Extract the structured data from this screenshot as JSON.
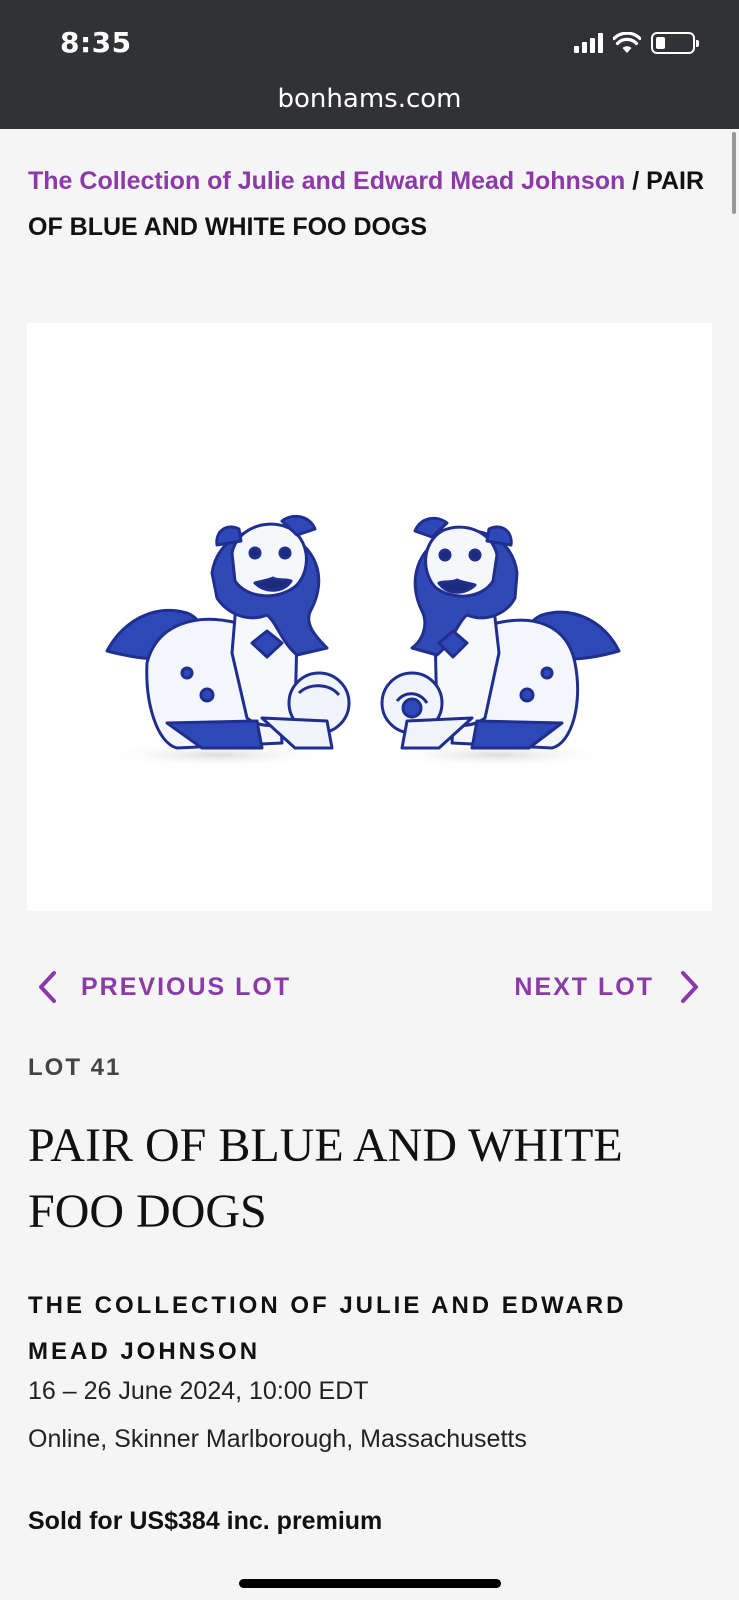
{
  "status_bar": {
    "time": "8:35"
  },
  "browser": {
    "url": "bonhams.com"
  },
  "breadcrumb": {
    "link": "The Collection of Julie and Edward Mead Johnson",
    "separator": " / ",
    "current": "PAIR OF BLUE AND WHITE FOO DOGS"
  },
  "lot_nav": {
    "previous_label": "PREVIOUS LOT",
    "next_label": "NEXT LOT"
  },
  "lot": {
    "number": "LOT 41",
    "title": "PAIR OF BLUE AND WHITE FOO DOGS"
  },
  "sale": {
    "title": "THE COLLECTION OF JULIE AND EDWARD MEAD JOHNSON",
    "date": "16 – 26 June 2024, 10:00 EDT",
    "location": "Online, Skinner Marlborough, Massachusetts"
  },
  "result": {
    "sold_text": "Sold for US$384 inc. premium"
  },
  "colors": {
    "accent": "#8b3aa8",
    "topbar": "#303236",
    "background": "#f5f5f5",
    "porcelain_blue": "#2a3fa6"
  }
}
